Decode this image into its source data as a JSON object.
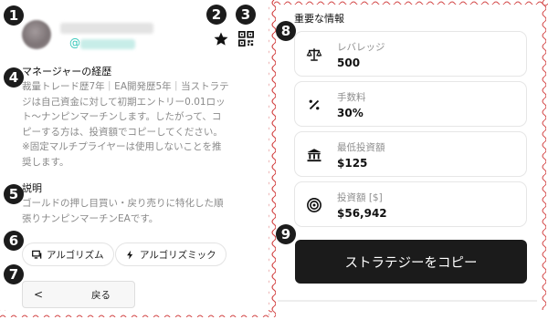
{
  "markers": [
    "1",
    "2",
    "3",
    "4",
    "5",
    "6",
    "7",
    "8",
    "9"
  ],
  "colors": {
    "accent": "#32c6b8",
    "scallop": "#d44a4a",
    "button_dark": "#1b1b1b",
    "muted_text": "#8a8a8a"
  },
  "profile": {
    "handle_prefix": "@",
    "star_icon": "star-icon",
    "qr_icon": "qr-code-icon"
  },
  "manager": {
    "heading": "マネージャーの経歴",
    "lines": [
      "裁量トレード歴7年｜EA開発歴5年｜当ストラテ",
      "ジは自己資金に対して初期エントリー0.01ロッ",
      "ト〜ナンピンマーチンします。したがって、コ",
      "ピーする方は、投資額でコピーしてください。",
      "※固定マルチプライヤーは使用しないことを推",
      "奨します。"
    ]
  },
  "description": {
    "heading": "説明",
    "lines": [
      "ゴールドの押し目買い・戻り売りに特化した順",
      "張りナンピンマーチンEAです。"
    ]
  },
  "tags": [
    {
      "label": "アルゴリズム",
      "icon": "monitor-icon"
    },
    {
      "label": "アルゴリズミック",
      "icon": "lightning-icon"
    }
  ],
  "back": {
    "chevron": "<",
    "label": "戻る"
  },
  "important": {
    "title": "重要な情報",
    "cards": [
      {
        "label": "レバレッジ",
        "value": "500",
        "icon": "scale-icon"
      },
      {
        "label": "手数料",
        "value": "30%",
        "icon": "percent-icon"
      },
      {
        "label": "最低投資額",
        "value": "$125",
        "icon": "bank-icon"
      },
      {
        "label": "投資額 [$]",
        "value": "$56,942",
        "icon": "target-icon"
      }
    ]
  },
  "copy_button": {
    "label": "ストラテジーをコピー"
  }
}
